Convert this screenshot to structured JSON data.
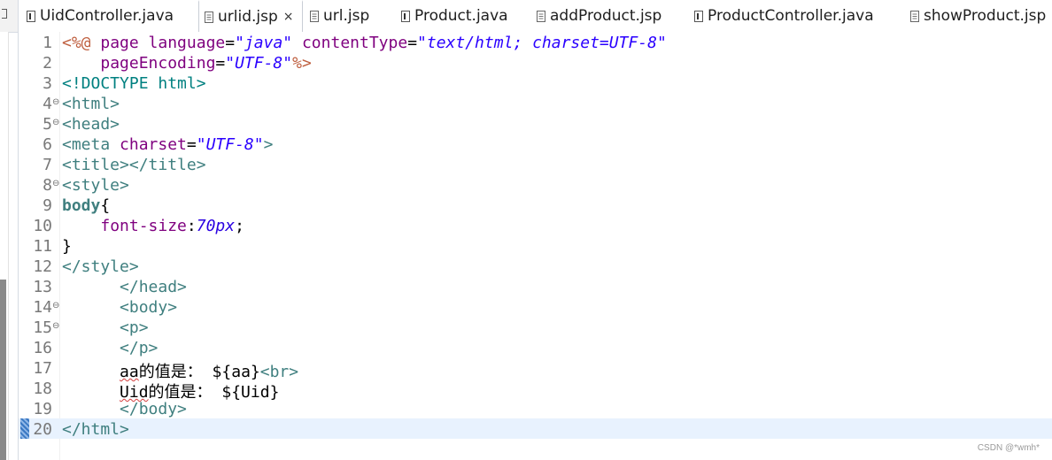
{
  "tabs": [
    {
      "label": "UidController.java",
      "icon": "java-file-icon",
      "active": false
    },
    {
      "label": "urlid.jsp",
      "icon": "jsp-file-icon",
      "active": true,
      "close": "×"
    },
    {
      "label": "url.jsp",
      "icon": "jsp-file-icon",
      "active": false
    },
    {
      "label": "Product.java",
      "icon": "java-file-icon",
      "active": false
    },
    {
      "label": "addProduct.jsp",
      "icon": "jsp-file-icon",
      "active": false
    },
    {
      "label": "ProductController.java",
      "icon": "java-file-icon",
      "active": false
    },
    {
      "label": "showProduct.jsp",
      "icon": "jsp-file-icon",
      "active": false
    }
  ],
  "editor": {
    "current_line": 20,
    "lines": [
      {
        "n": "1",
        "fold": false,
        "tokens": [
          [
            "t-dir",
            "<%@ "
          ],
          [
            "t-attr",
            "page language"
          ],
          [
            "t-txt",
            "="
          ],
          [
            "t-str",
            "\"java\""
          ],
          [
            "t-txt",
            " "
          ],
          [
            "t-attr",
            "contentType"
          ],
          [
            "t-txt",
            "="
          ],
          [
            "t-str",
            "\"text/html; charset=UTF-8\""
          ]
        ]
      },
      {
        "n": "2",
        "fold": false,
        "tokens": [
          [
            "t-txt",
            "    "
          ],
          [
            "t-attr",
            "pageEncoding"
          ],
          [
            "t-txt",
            "="
          ],
          [
            "t-str",
            "\"UTF-8\""
          ],
          [
            "t-dir",
            "%>"
          ]
        ]
      },
      {
        "n": "3",
        "fold": false,
        "tokens": [
          [
            "t-doct",
            "<!DOCTYPE html>"
          ]
        ]
      },
      {
        "n": "4",
        "fold": true,
        "tokens": [
          [
            "t-tag",
            "<html>"
          ]
        ]
      },
      {
        "n": "5",
        "fold": true,
        "tokens": [
          [
            "t-tag",
            "<head>"
          ]
        ]
      },
      {
        "n": "6",
        "fold": false,
        "tokens": [
          [
            "t-tag",
            "<meta "
          ],
          [
            "t-attr",
            "charset"
          ],
          [
            "t-txt",
            "="
          ],
          [
            "t-str",
            "\"UTF-8\""
          ],
          [
            "t-tag",
            ">"
          ]
        ]
      },
      {
        "n": "7",
        "fold": false,
        "tokens": [
          [
            "t-tag",
            "<title></title>"
          ]
        ]
      },
      {
        "n": "8",
        "fold": true,
        "tokens": [
          [
            "t-tag",
            "<style>"
          ]
        ]
      },
      {
        "n": "9",
        "fold": false,
        "tokens": [
          [
            "t-sel",
            "body"
          ],
          [
            "t-txt",
            "{"
          ]
        ]
      },
      {
        "n": "10",
        "fold": false,
        "tokens": [
          [
            "t-txt",
            "    "
          ],
          [
            "t-prop",
            "font-size"
          ],
          [
            "t-txt",
            ":"
          ],
          [
            "t-num",
            "70px"
          ],
          [
            "t-txt",
            ";"
          ]
        ]
      },
      {
        "n": "11",
        "fold": false,
        "tokens": [
          [
            "t-txt",
            "}"
          ]
        ]
      },
      {
        "n": "12",
        "fold": false,
        "tokens": [
          [
            "t-tag",
            "</style>"
          ]
        ]
      },
      {
        "n": "13",
        "fold": false,
        "tokens": [
          [
            "t-txt",
            "      "
          ],
          [
            "t-tag",
            "</head>"
          ]
        ]
      },
      {
        "n": "14",
        "fold": true,
        "tokens": [
          [
            "t-txt",
            "      "
          ],
          [
            "t-tag",
            "<body>"
          ]
        ]
      },
      {
        "n": "15",
        "fold": true,
        "tokens": [
          [
            "t-txt",
            "      "
          ],
          [
            "t-tag",
            "<p>"
          ]
        ]
      },
      {
        "n": "16",
        "fold": false,
        "tokens": [
          [
            "t-txt",
            "      "
          ],
          [
            "t-tag",
            "</p>"
          ]
        ]
      },
      {
        "n": "17",
        "fold": false,
        "tokens": [
          [
            "t-txt",
            "      "
          ],
          [
            "t-txt t-spell",
            "aa"
          ],
          [
            "t-txt t-cjk",
            "的值是："
          ],
          [
            "t-txt",
            " ${aa}"
          ],
          [
            "t-tag",
            "<br>"
          ]
        ]
      },
      {
        "n": "18",
        "fold": false,
        "tokens": [
          [
            "t-txt",
            "      "
          ],
          [
            "t-txt t-spell",
            "Uid"
          ],
          [
            "t-txt t-cjk",
            "的值是："
          ],
          [
            "t-txt",
            " ${Uid}"
          ]
        ]
      },
      {
        "n": "19",
        "fold": false,
        "tokens": [
          [
            "t-txt",
            "      "
          ],
          [
            "t-tag",
            "</body>"
          ]
        ]
      },
      {
        "n": "20",
        "fold": false,
        "tokens": [
          [
            "t-tag",
            "</html>"
          ]
        ]
      }
    ]
  },
  "watermark": "CSDN @*wmh*",
  "colors": {
    "tag": "#3f7f7f",
    "attribute": "#7f007f",
    "string": "#2a00ff",
    "directive": "#bf5f3f",
    "current_line": "#e8f2fe"
  }
}
